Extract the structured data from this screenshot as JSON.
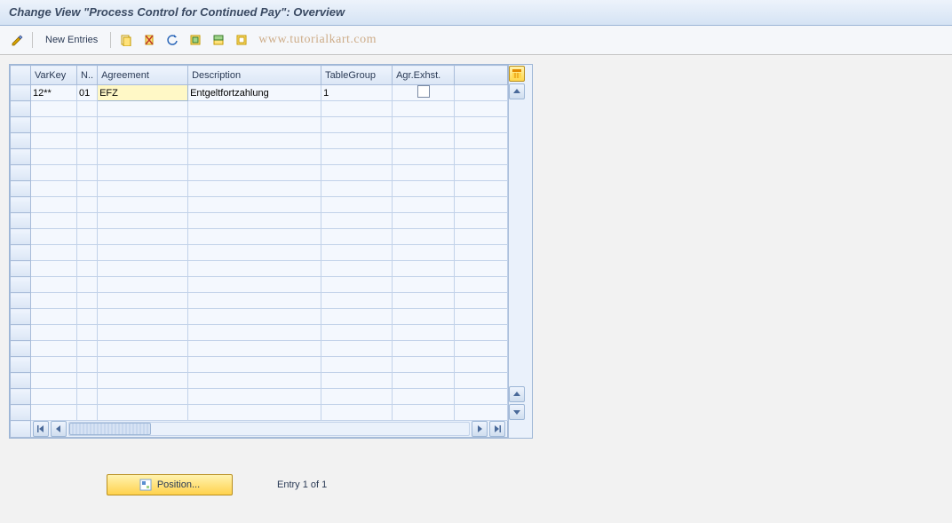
{
  "title": "Change View \"Process Control for Continued Pay\": Overview",
  "toolbar": {
    "new_entries_label": "New Entries"
  },
  "watermark": "www.tutorialkart.com",
  "columns": {
    "varkey": "VarKey",
    "n": "N..",
    "agreement": "Agreement",
    "description": "Description",
    "tablegroup": "TableGroup",
    "agrexhst": "Agr.Exhst."
  },
  "rows": [
    {
      "varkey": "12**",
      "n": "01",
      "agreement": "EFZ",
      "description": "Entgeltfortzahlung",
      "tablegroup": "1",
      "agrexhst": false
    }
  ],
  "position_button_label": "Position...",
  "entry_counter": "Entry 1 of 1"
}
